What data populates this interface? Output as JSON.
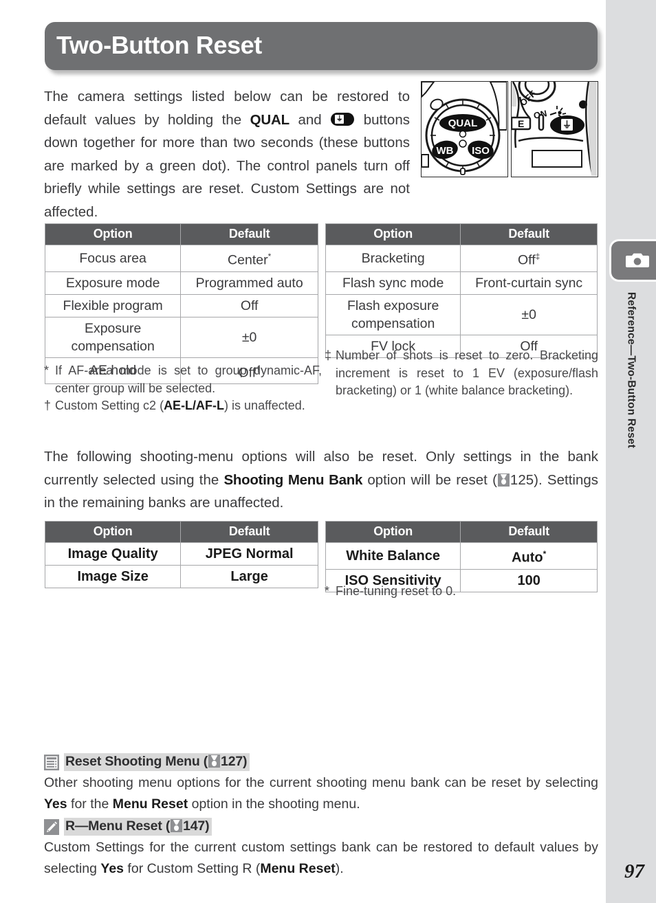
{
  "page": {
    "title": "Two-Button Reset",
    "number": "97",
    "side_label": "Reference—Two-Button Reset",
    "side_tab_icon": "camera-icon"
  },
  "intro": {
    "part1": "The camera settings listed below can be restored to default values by holding the ",
    "qual": "QUAL",
    "part2": " and ",
    "button_icon": "exposure-compensation-button-icon",
    "part3": " buttons down together for more than two seconds (these buttons are marked by a green dot). The control panels turn off briefly while settings are reset.  Custom Settings are not affected."
  },
  "illustration": {
    "left_photo": {
      "name": "camera-mode-dial-photo",
      "labels": [
        "QUAL",
        "WB",
        "ISO"
      ]
    },
    "right_photo": {
      "name": "camera-power-switch-photo",
      "labels": [
        "OFF",
        "ON",
        "E"
      ]
    }
  },
  "tables": {
    "table1": {
      "name": "basic-settings-table",
      "headers": [
        "Option",
        "Default"
      ],
      "rows": [
        {
          "option": "Focus area",
          "default": "Center",
          "default_fn": "*"
        },
        {
          "option": "Exposure mode",
          "default": "Programmed auto",
          "default_fn": ""
        },
        {
          "option": "Flexible program",
          "default": "Off",
          "default_fn": ""
        },
        {
          "option": "Exposure compensation",
          "default": "±0",
          "default_fn": ""
        },
        {
          "option": "AE hold",
          "default": "Off",
          "default_fn": "†"
        }
      ]
    },
    "table2": {
      "name": "flash-settings-table",
      "headers": [
        "Option",
        "Default"
      ],
      "rows": [
        {
          "option": "Bracketing",
          "default": "Off",
          "default_fn": "‡"
        },
        {
          "option": "Flash sync mode",
          "default": "Front-curtain sync",
          "default_fn": ""
        },
        {
          "option": "Flash exposure compensation",
          "default": "±0",
          "default_fn": ""
        },
        {
          "option": "FV lock",
          "default": "Off",
          "default_fn": ""
        }
      ]
    },
    "table3": {
      "name": "image-settings-table",
      "headers": [
        "Option",
        "Default"
      ],
      "rows": [
        {
          "option": "Image Quality",
          "default": "JPEG Normal",
          "default_fn": ""
        },
        {
          "option": "Image Size",
          "default": "Large",
          "default_fn": ""
        }
      ]
    },
    "table4": {
      "name": "white-balance-iso-table",
      "headers": [
        "Option",
        "Default"
      ],
      "rows": [
        {
          "option": "White Balance",
          "default": "Auto",
          "default_fn": "*"
        },
        {
          "option": "ISO Sensitivity",
          "default": "100",
          "default_fn": ""
        }
      ]
    }
  },
  "footnotes": {
    "star_left": {
      "mark": "*",
      "text": "If AF-area mode is set to group dynamic-AF, center group will be selected."
    },
    "dagger_left": {
      "mark": "†",
      "text_a": "Custom Setting c2 (",
      "bold": "AE-L/AF-L",
      "text_b": ") is unaffected."
    },
    "doubledagger_right": {
      "mark": "‡",
      "text": "Number of shots is reset to zero.  Bracketing increment is reset to 1 EV (exposure/flash bracketing) or 1 (white balance bracketing)."
    },
    "star_right": {
      "mark": "*",
      "text": "Fine-tuning reset to 0."
    }
  },
  "mid_paragraph": {
    "part1": "The following shooting-menu options will also be reset.  Only settings in the bank currently selected using the ",
    "bold": "Shooting Menu Bank",
    "part2": " option will be reset (",
    "ref_icon": "page-reference-icon",
    "page_ref": "125",
    "part3": ").  Settings in the remaining banks are unaffected."
  },
  "notes": [
    {
      "name": "note-reset-shooting-menu",
      "icon": "menu-list-icon",
      "heading_text": "Reset Shooting Menu (",
      "heading_ref_icon": "page-reference-icon",
      "heading_page": "127",
      "heading_close": ")",
      "body_a": "Other shooting menu options for the current shooting menu bank can be reset by selecting ",
      "bold_a": "Yes",
      "body_b": " for the ",
      "bold_b": "Menu Reset",
      "body_c": " option in the shooting menu."
    },
    {
      "name": "note-r-menu-reset",
      "icon": "pencil-icon",
      "heading_text": "R—Menu Reset (",
      "heading_ref_icon": "page-reference-icon",
      "heading_page": "147",
      "heading_close": ")",
      "body_a": "Custom Settings for the current custom settings bank can be restored to default values by selecting ",
      "bold_a": "Yes",
      "body_b": " for Custom Setting R (",
      "bold_b": "Menu Reset",
      "body_c": ")."
    }
  ],
  "colors": {
    "banner": "#6f7072",
    "table_header": "#5a5b5d",
    "side_band": "#dcdddf",
    "side_tab": "#7a7a7c",
    "body_text": "#3b3b3d"
  }
}
